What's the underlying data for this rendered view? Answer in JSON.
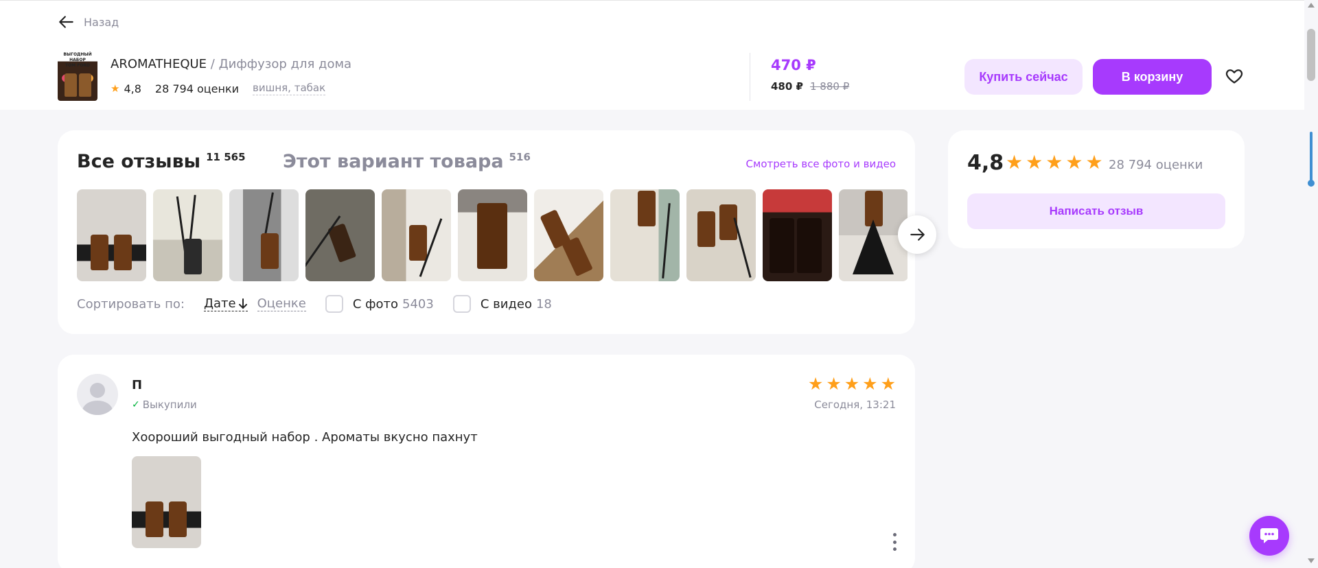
{
  "header": {
    "back_label": "Назад",
    "product_brand": "AROMATHEQUE",
    "product_sep": " / ",
    "product_name": "Диффузор для дома",
    "thumb_text": "ВЫГОДНЫЙ НАБОР TOM FORD",
    "rating": "4,8",
    "reviews_count": "28 794 оценки",
    "variant": "вишня, табак",
    "price_main": "470 ₽",
    "price_wallet": "480 ₽",
    "price_old": "1 880 ₽",
    "buy_now": "Купить сейчас",
    "add_to_cart": "В корзину"
  },
  "reviews_block": {
    "all_reviews_title": "Все отзывы",
    "all_reviews_count": "11 565",
    "variant_title": "Этот вариант товара",
    "variant_count": "516",
    "see_all_media": "Смотреть все фото и видео",
    "sort_label": "Сортировать по:",
    "sort_date": "Дате",
    "sort_grade": "Оценке",
    "with_photo_label": "С фото",
    "with_photo_count": "5403",
    "with_video_label": "С видео",
    "with_video_count": "18"
  },
  "rating_card": {
    "rating": "4,8",
    "stars": 5,
    "count": "28 794 оценки",
    "write_review": "Написать отзыв"
  },
  "review": {
    "author": "П",
    "bought": "Выкупили",
    "stars": 5,
    "date": "Сегодня, 13:21",
    "text": "Хоороший выгодный набор . Ароматы вкусно пахнут"
  },
  "colors": {
    "accent": "#a73afd",
    "accent_light": "#f3e6ff",
    "star": "#ff9f1a",
    "muted": "#8b8b9a",
    "check_green": "#00b33c"
  },
  "icons": [
    "arrow-left-icon",
    "star-icon",
    "heart-icon",
    "arrow-right-icon",
    "arrow-down-icon",
    "checkmark-icon",
    "kebab-menu-icon",
    "chat-icon"
  ]
}
